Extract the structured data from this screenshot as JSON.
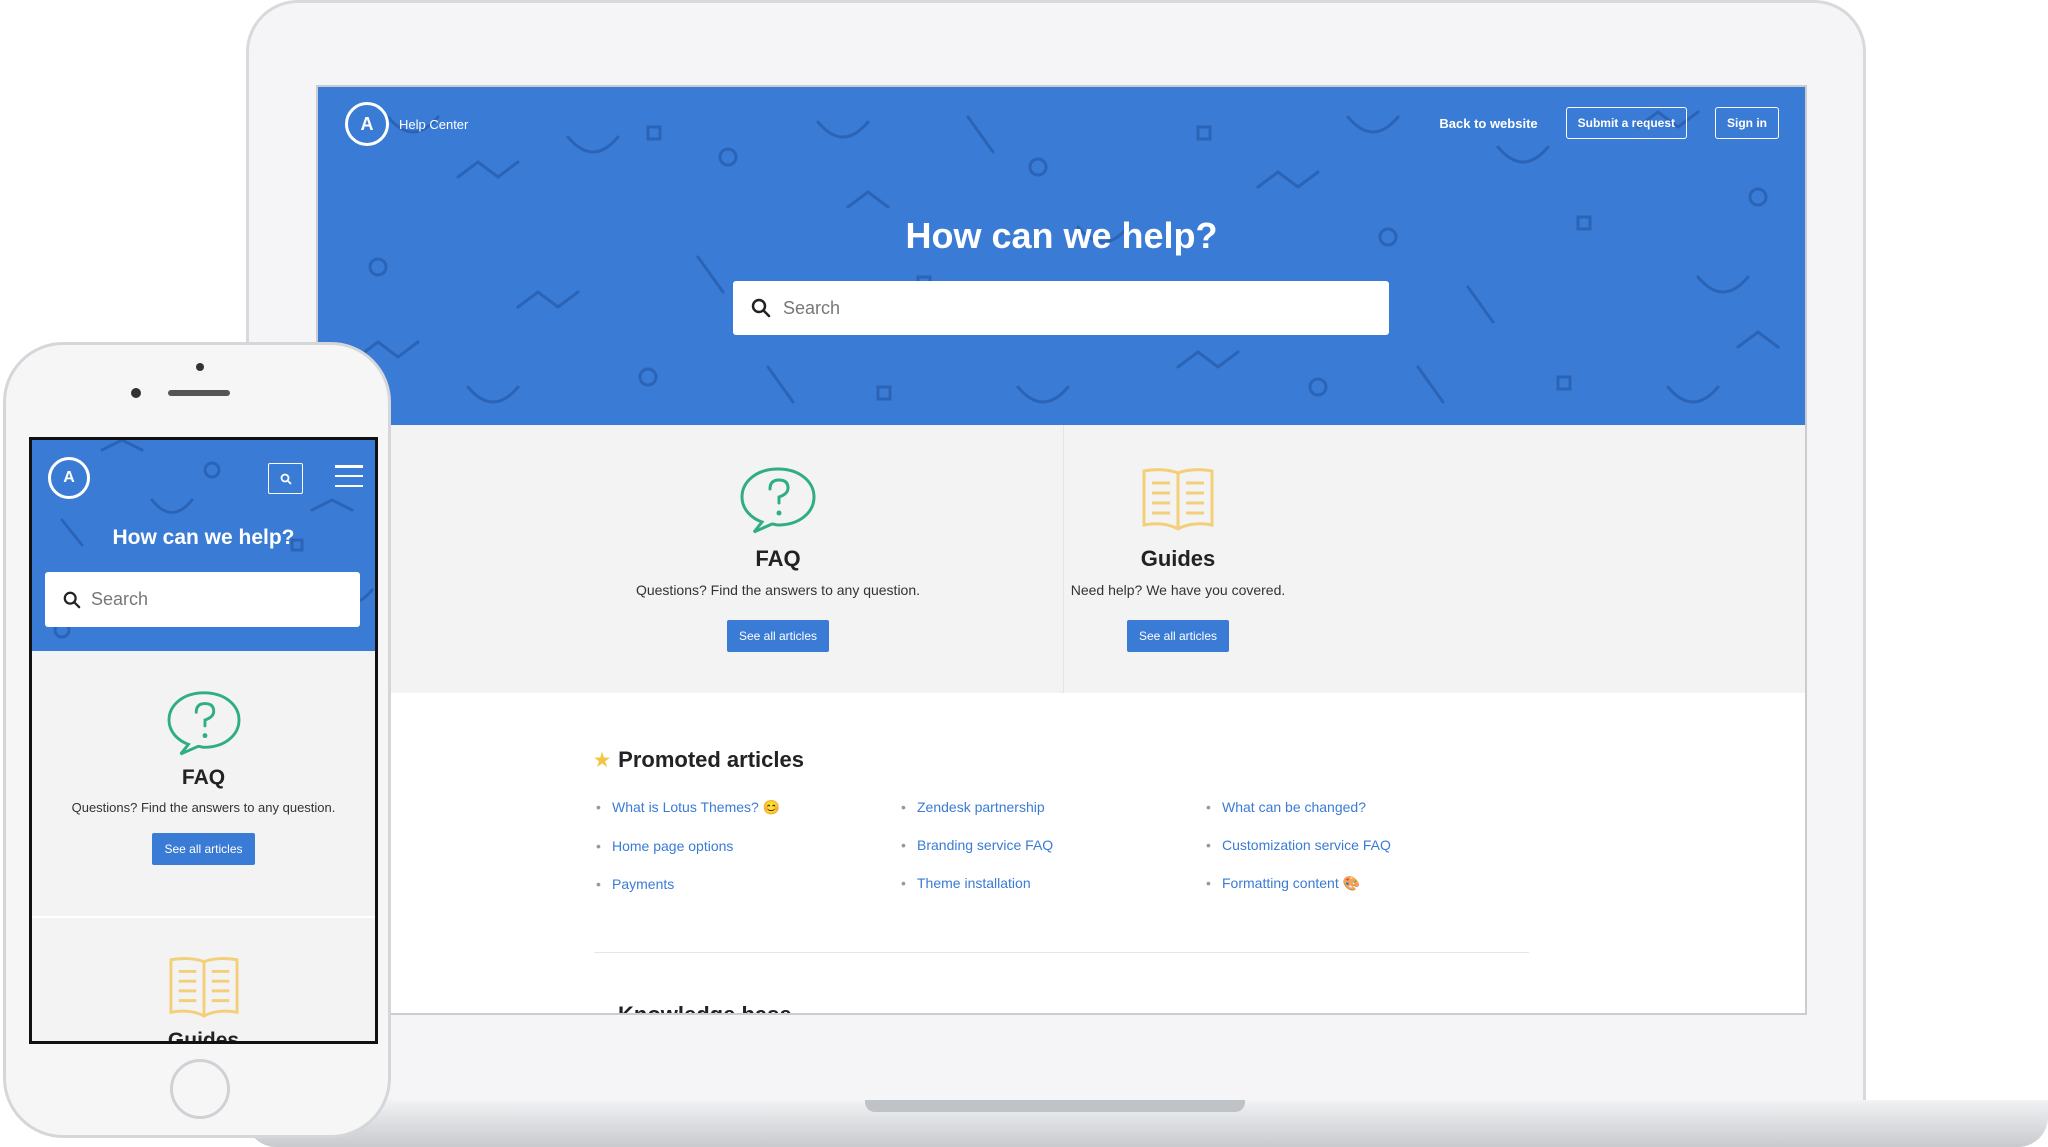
{
  "laptop": {
    "brand_logo": "A",
    "brand_text": "Help Center",
    "nav": {
      "back_link": "Back to website",
      "submit_request": "Submit a request",
      "sign_in": "Sign in"
    },
    "hero_title": "How can we help?",
    "search_placeholder": "Search",
    "categories": [
      {
        "icon": "question-bubble-icon",
        "title": "FAQ",
        "description": "Questions? Find the answers to any question.",
        "button": "See all articles"
      },
      {
        "icon": "open-book-icon",
        "title": "Guides",
        "description": "Need help? We have you covered.",
        "button": "See all articles"
      }
    ],
    "promoted": {
      "title": "Promoted articles",
      "columns": [
        [
          "What is Lotus Themes? 😊",
          "Home page options",
          "Payments"
        ],
        [
          "Zendesk partnership",
          "Branding service FAQ",
          "Theme installation"
        ],
        [
          "What can be changed?",
          "Customization service FAQ",
          "Formatting content 🎨"
        ]
      ]
    },
    "next_section_title": "Knowledge base"
  },
  "phone": {
    "logo": "A",
    "hero_title": "How can we help?",
    "search_placeholder": "Search",
    "category": {
      "icon": "question-bubble-icon",
      "title": "FAQ",
      "description": "Questions? Find the answers to any question.",
      "button": "See all articles"
    },
    "category2": {
      "icon": "open-book-icon",
      "title": "Guides"
    }
  },
  "colors": {
    "primary": "#3a7bd5",
    "faq_icon": "#2fae86",
    "guides_icon": "#f4cf7a",
    "star": "#f4c542"
  }
}
